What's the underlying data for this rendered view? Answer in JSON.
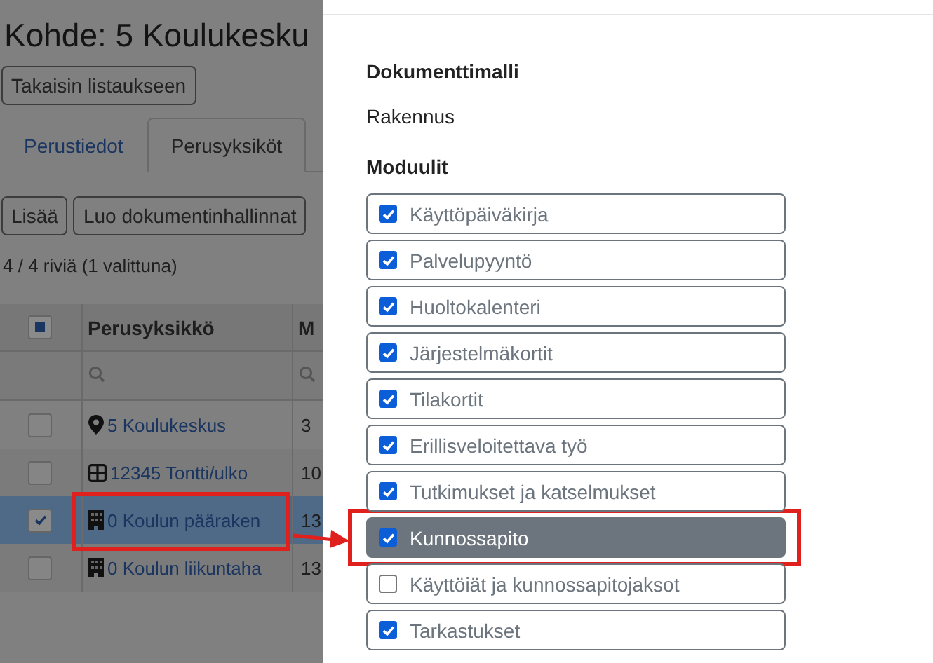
{
  "page": {
    "title": "Kohde: 5 Koulukesku",
    "back_button": "Takaisin listaukseen"
  },
  "tabs": [
    {
      "label": "Perustiedot",
      "selected": false
    },
    {
      "label": "Perusyksiköt",
      "selected": true
    }
  ],
  "actions": [
    "Lisää",
    "Luo dokumentinhallinnat"
  ],
  "row_count": "4 / 4 riviä (1 valittuna)",
  "table": {
    "partially_selected": true,
    "columns": [
      "Perusyksikkö",
      "M"
    ],
    "rows": [
      {
        "selected": false,
        "kind": "pin",
        "name": "5 Koulukeskus",
        "column_3": "3",
        "annotated": false
      },
      {
        "selected": false,
        "kind": "grid",
        "name": "12345 Tontti/ulko",
        "column_3": "10",
        "annotated": false
      },
      {
        "selected": true,
        "kind": "building",
        "name": "0 Koulun pääraken",
        "column_3": "13",
        "annotated": true
      },
      {
        "selected": false,
        "kind": "building",
        "name": "0 Koulun liikuntaha",
        "column_3": "13",
        "annotated": false
      }
    ]
  },
  "drawer": {
    "template_label": "Dokumenttimalli",
    "template_value": "Rakennus",
    "modules_label": "Moduulit",
    "modules": [
      {
        "label": "Käyttöpäiväkirja",
        "checked": true,
        "highlighted": false,
        "annotated": false
      },
      {
        "label": "Palvelupyyntö",
        "checked": true,
        "highlighted": false,
        "annotated": false
      },
      {
        "label": "Huoltokalenteri",
        "checked": true,
        "highlighted": false,
        "annotated": false
      },
      {
        "label": "Järjestelmäkortit",
        "checked": true,
        "highlighted": false,
        "annotated": false
      },
      {
        "label": "Tilakortit",
        "checked": true,
        "highlighted": false,
        "annotated": false
      },
      {
        "label": "Erillisveloitettava työ",
        "checked": true,
        "highlighted": false,
        "annotated": false
      },
      {
        "label": "Tutkimukset ja katselmukset",
        "checked": true,
        "highlighted": false,
        "annotated": false
      },
      {
        "label": "Kunnossapito",
        "checked": true,
        "highlighted": true,
        "annotated": true
      },
      {
        "label": "Käyttöiät ja kunnossapitojaksot",
        "checked": false,
        "highlighted": false,
        "annotated": false
      },
      {
        "label": "Tarkastukset",
        "checked": true,
        "highlighted": false,
        "annotated": false
      }
    ]
  }
}
